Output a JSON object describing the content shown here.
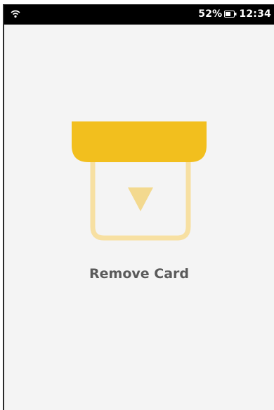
{
  "status_bar": {
    "battery_percent": "52%",
    "time": "12:34",
    "icons": [
      "wifi-icon",
      "battery-icon"
    ]
  },
  "prompt": {
    "message": "Remove Card"
  },
  "colors": {
    "reader_slot": "#f2bf1e",
    "card_outline": "#f7e0a2",
    "arrow": "#f3d98f",
    "text": "#5a5a5a",
    "background": "#f4f4f4"
  }
}
